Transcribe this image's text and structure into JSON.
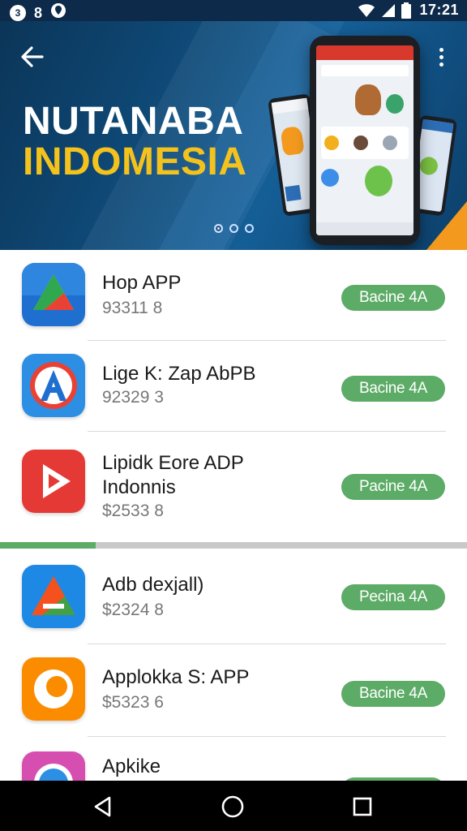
{
  "status_bar": {
    "left_icons": [
      "notification-badge-icon",
      "number-8-icon",
      "location-icon"
    ],
    "badge_text": "3",
    "num_text": "8",
    "right_icons": [
      "wifi-icon",
      "cell-signal-icon",
      "battery-icon"
    ],
    "time": "17:21"
  },
  "banner": {
    "title_line1": "NUTANABA",
    "title_line2": "INDOMESIA",
    "title_line1_color": "#ffffff",
    "title_line2_color": "#f4c21d",
    "background_color": "#0f4a78",
    "page_count": 3,
    "active_page": 1,
    "back_icon": "arrow-left-icon",
    "menu_icon": "more-vert-icon"
  },
  "apps": [
    {
      "name": "Hop APP",
      "price": "93311 8",
      "button": "Bacine 4A",
      "icon": "drive-triangle-icon"
    },
    {
      "name": "Lige K: Zap AbPB",
      "price": "92329 3",
      "button": "Bacine 4A",
      "icon": "letter-a-circle-icon"
    },
    {
      "name_line1": "Lipidk Eore ADP",
      "name_line2": "Indonnis",
      "price": "$2533 8",
      "button": "Pacine 4A",
      "icon": "play-icon"
    },
    {
      "name": "Adb dexjall)",
      "price": "$2324 8",
      "button": "Pecina 4A",
      "icon": "triangle-arrow-icon"
    },
    {
      "name": "Applokka S: APP",
      "price": "$5323 6",
      "button": "Bacine 4A",
      "icon": "letter-c-icon"
    },
    {
      "name": "Apkike",
      "price": "",
      "button": "",
      "icon": "compass-icon"
    }
  ],
  "accent_color": "#5cab66",
  "nav_bar": {
    "icons": [
      "back-triangle-icon",
      "home-circle-icon",
      "recents-square-icon"
    ]
  }
}
